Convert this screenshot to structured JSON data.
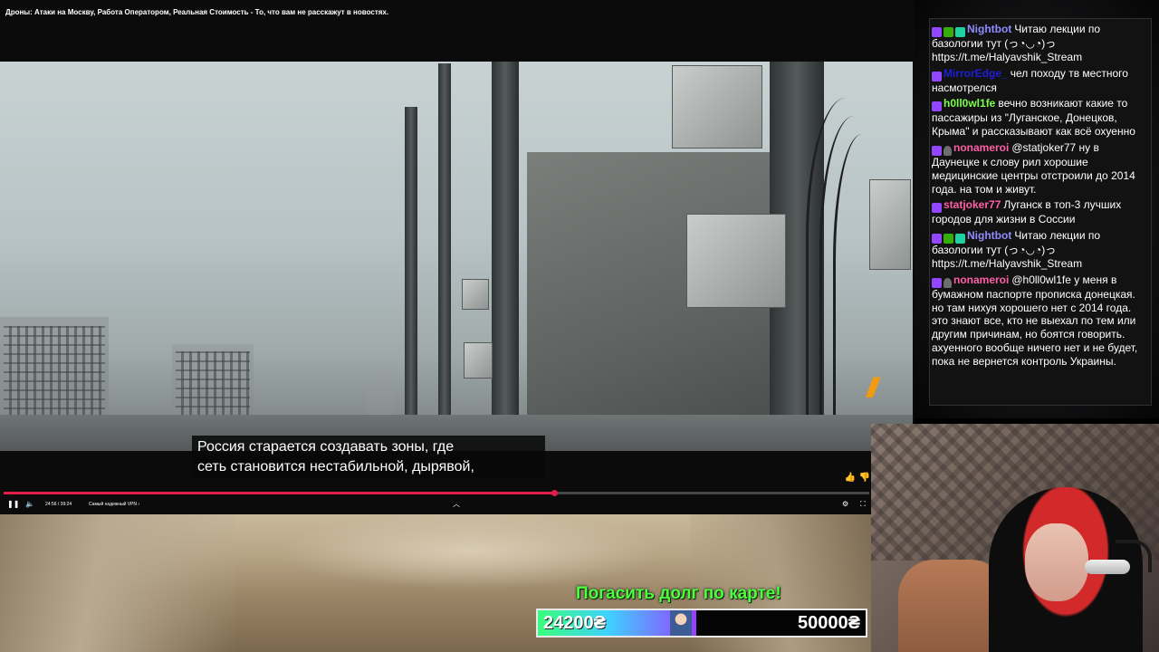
{
  "player": {
    "title": "Дроны: Атаки на Москву, Работа Оператором, Реальная Стоимость - То, что вам не расскажут в новостях.",
    "subtitle_lines": [
      "Россия старается создавать зоны, где",
      "сеть становится нестабильной, дырявой,"
    ],
    "time": "24:56 / 39:24",
    "chapter": "Самый надежный VPN",
    "progress": 0.636,
    "accent_color": "#e11d48"
  },
  "goal": {
    "title": "Погасить долг по карте!",
    "current": "24200₴",
    "target": "50000₴",
    "fraction": 0.484
  },
  "chat": {
    "messages": [
      {
        "badges": [
          "twitch",
          "mod",
          "bot"
        ],
        "user": "Nightbot",
        "color": "#8f8cff",
        "text": "Читаю лекции по базологии тут (っ◔◡◔)っ https://t.me/Halyavshik_Stream"
      },
      {
        "badges": [
          "twitch"
        ],
        "user": "MirrorEdge_",
        "color": "#1e1ed8",
        "text": "чел походу тв местного насмотрелся"
      },
      {
        "badges": [
          "twitch"
        ],
        "user": "h0ll0wl1fe",
        "color": "#7cff4a",
        "text": "вечно возникают какие то пассажиры из \"Луганское, Донецков, Крыма\" и рассказывают как всё охуенно"
      },
      {
        "badges": [
          "twitch",
          "hell"
        ],
        "user": "nonameroi",
        "color": "#ff5fa8",
        "text": "@statjoker77 ну в Даунецке к слову рил хорошие медицинские центры отстроили до 2014 года. на том и живут."
      },
      {
        "badges": [
          "twitch"
        ],
        "user": "statjoker77",
        "color": "#ff5fa8",
        "text": "Луганск в топ-3 лучших городов для жизни в Соссии"
      },
      {
        "badges": [
          "twitch",
          "mod",
          "bot"
        ],
        "user": "Nightbot",
        "color": "#8f8cff",
        "text": "Читаю лекции по базологии тут (っ◔◡◔)っ https://t.me/Halyavshik_Stream"
      },
      {
        "badges": [
          "twitch",
          "hell"
        ],
        "user": "nonameroi",
        "color": "#ff5fa8",
        "text": "@h0ll0wl1fe у меня в бумажном паспорте прописка донецкая. но там нихуя хорошего нет с 2014 года. это знают все, кто не выехал по тем или другим причинам, но боятся говорить. ахуенного вообще ничего нет и не будет, пока не вернется контроль Украины."
      }
    ]
  }
}
